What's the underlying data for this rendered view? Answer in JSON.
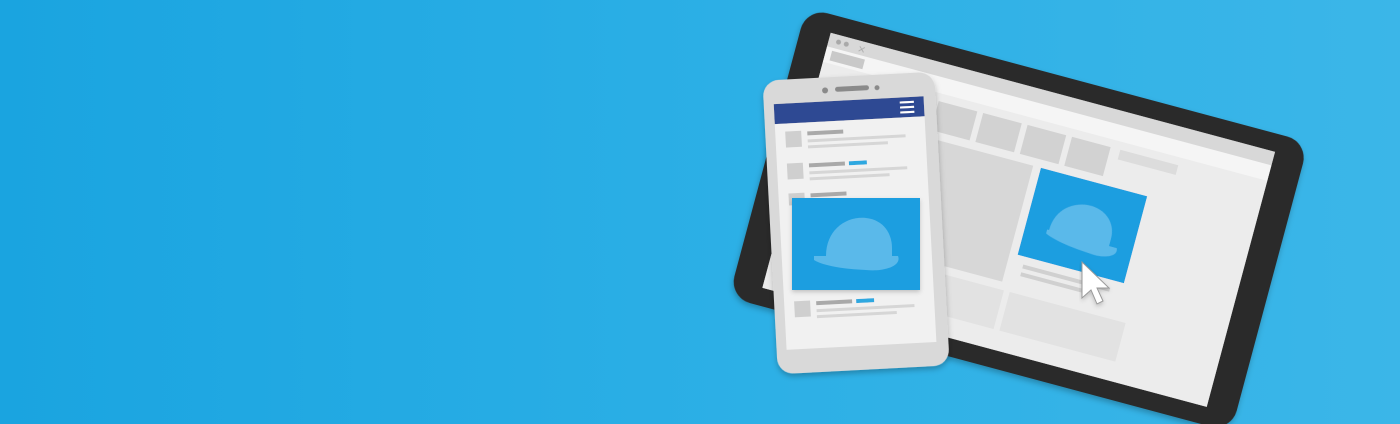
{
  "scene": {
    "kind": "marketing-banner-illustration",
    "devices": [
      "tablet",
      "phone"
    ],
    "ad_image_icon": "baseball-cap-icon",
    "pointer_icon": "cursor-arrow-icon",
    "menu_icon": "hamburger-menu-icon"
  },
  "colors": {
    "background": "#22aae4",
    "tablet_frame": "#2c2c2c",
    "screen": "#ececec",
    "placeholder": "#cfcfcf",
    "ad_blue": "#1f9ee0",
    "cap_blue": "#5ab9ea",
    "phone_header": "#2e4a93",
    "phone_body": "#d9d9d9",
    "accent_link": "#2fa8e0"
  }
}
